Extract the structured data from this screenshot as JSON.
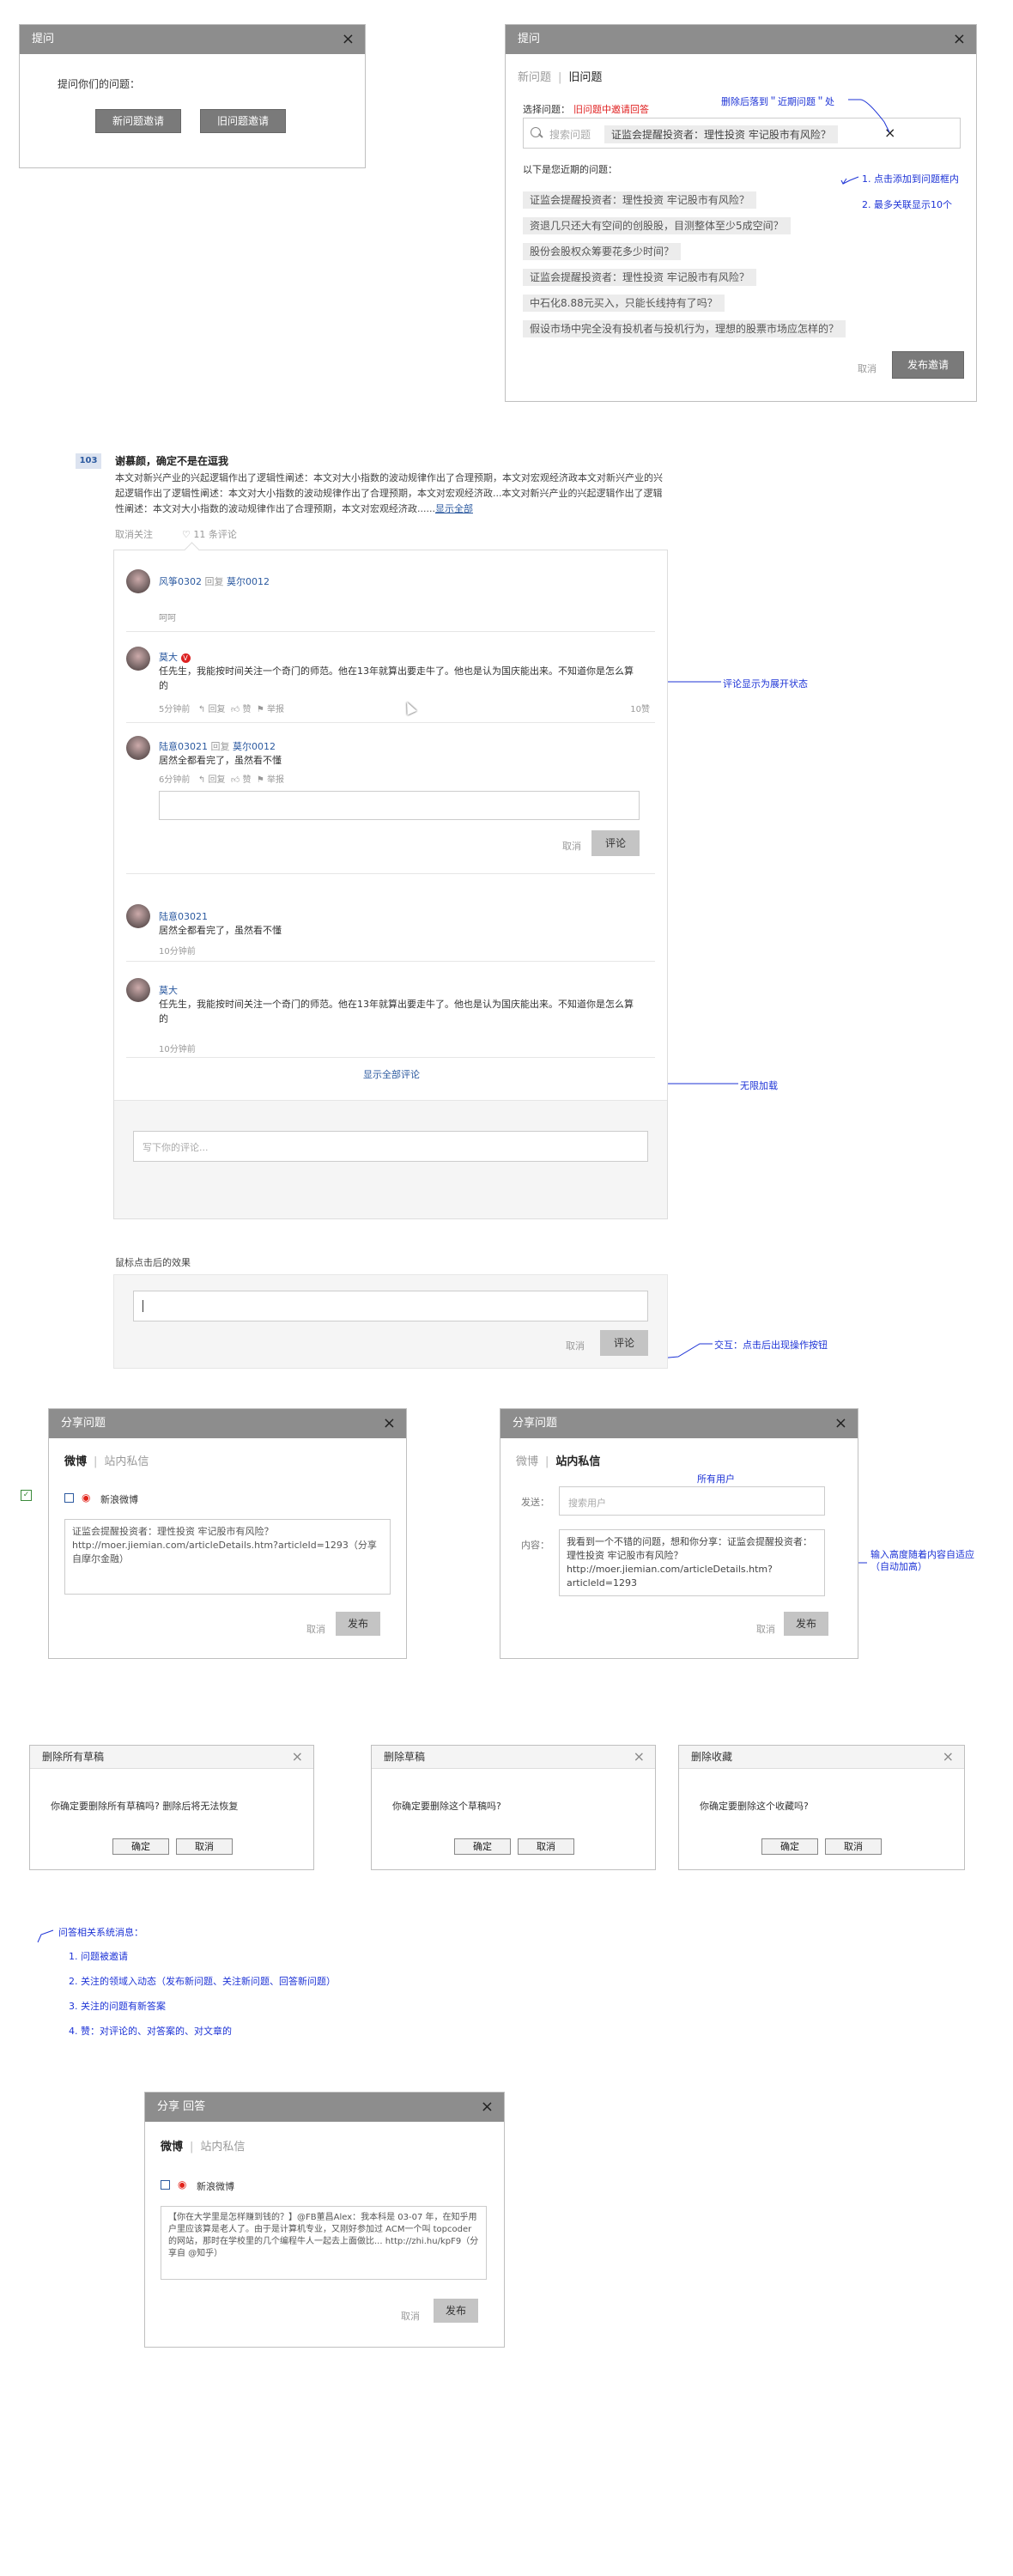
{
  "dialog1": {
    "title": "提问",
    "question": "提问你们的问题：",
    "btn_new": "新问题邀请",
    "btn_old": "旧问题邀请"
  },
  "dialog2": {
    "title": "提问",
    "tab_new": "新问题",
    "tab_old": "旧问题",
    "select_label": "选择问题：",
    "select_note": "旧问题中邀请回答",
    "search_placeholder": "搜索问题",
    "selected_question": "证监会提醒投资者：理性投资 牢记股市有风险？",
    "recent_label": "以下是您近期的问题：",
    "recent": [
      "证监会提醒投资者：理性投资 牢记股市有风险？",
      "资退几只还大有空间的创股股，目测整体至少5成空间？",
      "股份会股权众筹要花多少时间？",
      "证监会提醒投资者：理性投资 牢记股市有风险？",
      "中石化8.88元买入，只能长线持有了吗？",
      "假设市场中完全没有投机者与投机行为，理想的股票市场应怎样的？"
    ],
    "cancel": "取消",
    "publish": "发布邀请"
  },
  "annotations": {
    "delete_to_recent": "删除后落到＂近期问题＂处",
    "click_add": "1. 点击添加到问题框内",
    "max_show": "2. 最多关联显示10个",
    "comment_expanded": "评论显示为展开状态",
    "infinite_load": "无限加载",
    "mouse_click_effect": "鼠标点击后的效果",
    "interaction_after_click": "交互：点击后出现操作按钮",
    "all_users": "所有用户",
    "auto_height": "输入高度随着内容自适应（自动加高）"
  },
  "answer": {
    "index": "103",
    "title": "谢慕颜，确定不是在逗我",
    "body": "本文对新兴产业的兴起逻辑作出了逻辑性阐述：本文对大小指数的波动规律作出了合理预期，本文对宏观经济政本文对新兴产业的兴起逻辑作出了逻辑性阐述：本文对大小指数的波动规律作出了合理预期，本文对宏观经济政...本文对新兴产业的兴起逻辑作出了逻辑性阐述：本文对大小指数的波动规律作出了合理预期，本文对宏观经济政......",
    "show_all": "显示全部",
    "cancel_follow": "取消关注",
    "comment_count": "11 条评论"
  },
  "comments": {
    "c1": {
      "name": "风筝0302",
      "reply": "回复",
      "to": "莫尔0012",
      "text": "呵呵"
    },
    "c2": {
      "name": "莫大",
      "text": "任先生，我能按时间关注一个奇门的师范。他在13年就算出要走牛了。他也是认为国庆能出来。不知道你是怎么算的",
      "time": "5分钟前",
      "actions": [
        "回复",
        "赞",
        "举报"
      ],
      "likes": "10赞"
    },
    "c3": {
      "name": "陆意03021",
      "reply": "回复",
      "to": "莫尔0012",
      "text": "居然全都看完了，虽然看不懂",
      "time": "6分钟前",
      "actions": [
        "回复",
        "赞",
        "举报"
      ],
      "cancel": "取消",
      "submit": "评论"
    },
    "c4": {
      "name": "陆意03021",
      "text": "居然全都看完了，虽然看不懂",
      "time": "10分钟前"
    },
    "c5": {
      "name": "莫大",
      "text": "任先生，我能按时间关注一个奇门的师范。他在13年就算出要走牛了。他也是认为国庆能出来。不知道你是怎么算的",
      "time": "10分钟前"
    },
    "show_all": "显示全部评论",
    "write_placeholder": "写下你的评论..."
  },
  "click_box": {
    "cancel": "取消",
    "submit": "评论"
  },
  "share1": {
    "title": "分享问题",
    "tab_weibo": "微博",
    "tab_msg": "站内私信",
    "sync_label": "新浪微博",
    "content": "证监会提醒投资者：理性投资 牢记股市有风险？http://moer.jiemian.com/articleDetails.htm?articleId=1293（分享自摩尔金融）",
    "cancel": "取消",
    "publish": "发布"
  },
  "share2": {
    "title": "分享问题",
    "tab_weibo": "微博",
    "tab_msg": "站内私信",
    "send_label": "发送：",
    "send_placeholder": "搜索用户",
    "content_label": "内容：",
    "content": "我看到一个不错的问题，想和你分享：证监会提醒投资者：理性投资 牢记股市有风险？http://moer.jiemian.com/articleDetails.htm?articleId=1293",
    "cancel": "取消",
    "publish": "发布"
  },
  "del1": {
    "title": "删除所有草稿",
    "text": "你确定要删除所有草稿吗? 删除后将无法恢复",
    "ok": "确定",
    "cancel": "取消"
  },
  "del2": {
    "title": "删除草稿",
    "text": "你确定要删除这个草稿吗?",
    "ok": "确定",
    "cancel": "取消"
  },
  "del3": {
    "title": "删除收藏",
    "text": "你确定要删除这个收藏吗?",
    "ok": "确定",
    "cancel": "取消"
  },
  "sysmsg": {
    "title": "问答相关系统消息：",
    "items": [
      "1. 问题被邀请",
      "2. 关注的领域入动态（发布新问题、关注新问题、回答新问题）",
      "3. 关注的问题有新答案",
      "4. 赞：对评论的、对答案的、对文章的"
    ]
  },
  "share3": {
    "title": "分享 回答",
    "tab_weibo": "微博",
    "tab_msg": "站内私信",
    "sync_label": "新浪微博",
    "content": "【你在大学里是怎样赚到钱的？】@FB董昌Alex：我本科是 03-07 年，在知乎用户里应该算是老人了。由于是计算机专业，又刚好参加过 ACM一个叫 topcoder 的网站，那时在学校里的几个编程牛人一起去上面做比... http://zhi.hu/kpF9（分享自 @知乎）",
    "cancel": "取消",
    "publish": "发布"
  },
  "colors": {
    "header": "#8d8d8d",
    "link": "#2c5aa0",
    "annotation": "#1d33d6",
    "note_red": "#e02020"
  }
}
